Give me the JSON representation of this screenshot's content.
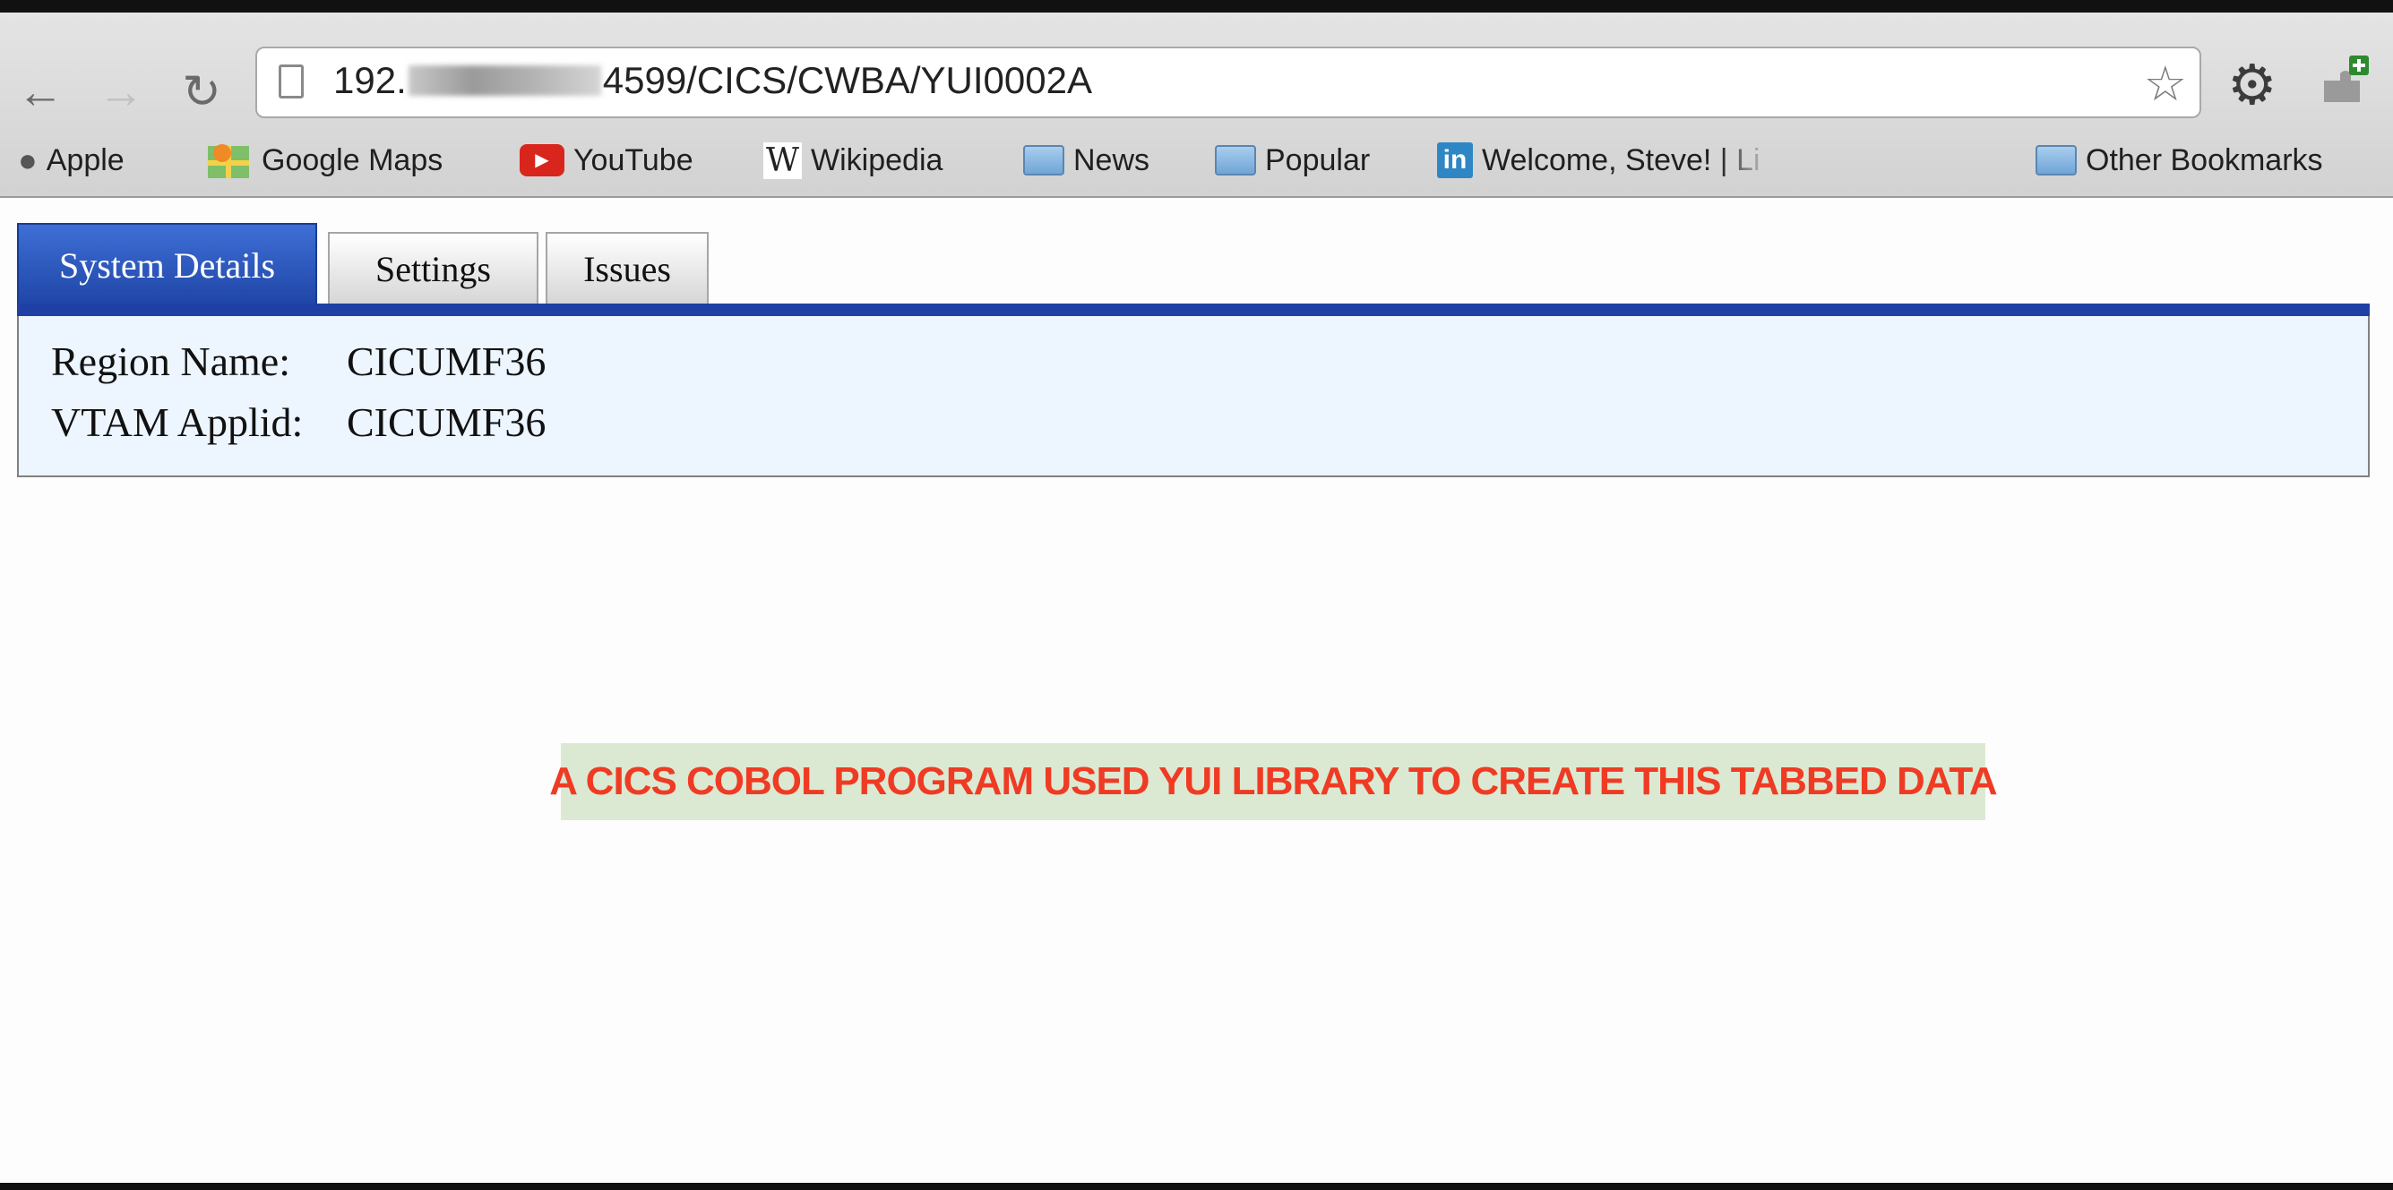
{
  "browser": {
    "url_prefix": "192.",
    "url_suffix": "4599/CICS/CWBA/YUI0002A",
    "nav": {
      "back_icon": "arrow-left-icon",
      "forward_icon": "arrow-right-icon",
      "reload_icon": "reload-icon"
    }
  },
  "bookmarks": [
    {
      "label": "Apple",
      "icon": "apple-icon"
    },
    {
      "label": "Google Maps",
      "icon": "google-maps-icon"
    },
    {
      "label": "YouTube",
      "icon": "youtube-icon"
    },
    {
      "label": "Wikipedia",
      "icon": "wikipedia-icon"
    },
    {
      "label": "News",
      "icon": "folder-icon"
    },
    {
      "label": "Popular",
      "icon": "folder-icon"
    },
    {
      "label": "Welcome, Steve! | Li",
      "icon": "linkedin-icon"
    },
    {
      "label": "Other Bookmarks",
      "icon": "folder-icon"
    }
  ],
  "tabs": [
    {
      "label": "System Details",
      "active": true
    },
    {
      "label": "Settings",
      "active": false
    },
    {
      "label": "Issues",
      "active": false
    }
  ],
  "panel": {
    "region_label": "Region Name:",
    "region_value": "CICUMF36",
    "vtam_label": "VTAM Applid:",
    "vtam_value": "CICUMF36"
  },
  "caption": "A CICS COBOL PROGRAM USED YUI LIBRARY TO CREATE THIS TABBED DATA",
  "colors": {
    "active_tab": "#2a55c0",
    "tab_strip": "#1e40a4",
    "panel_bg": "#edf5ff",
    "caption_text": "#ef3b24",
    "caption_bg": "#dce9d2"
  }
}
